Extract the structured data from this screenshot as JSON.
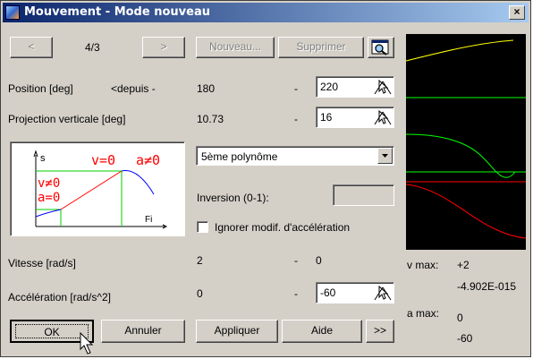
{
  "window": {
    "title": "Mouvement - Mode nouveau",
    "close": "×"
  },
  "nav": {
    "prev": "<",
    "page": "4/3",
    "next": ">"
  },
  "toolbar": {
    "nouveau": "Nouveau...",
    "supprimer": "Supprimer",
    "preview_icon": "magnifier-icon"
  },
  "position": {
    "label": "Position [deg]",
    "sub": "<depuis -",
    "value": "180",
    "dash": "-",
    "input": "220"
  },
  "projection": {
    "label": "Projection verticale [deg]",
    "value": "10.73",
    "dash": "-",
    "input": "16"
  },
  "diagram": {
    "s_label": "s",
    "v0": "v=0",
    "a_ne0": "a≠0",
    "v_ne0": "v≠0",
    "a0": "a=0",
    "fi": "Fi"
  },
  "profile": {
    "selected": "5ème polynôme"
  },
  "inversion": {
    "label": "Inversion (0-1):",
    "value": ""
  },
  "ignore_accel": {
    "label": "Ignorer modif. d'accélération",
    "checked": false
  },
  "vitesse": {
    "label": "Vitesse [rad/s]",
    "value": "2",
    "dash": "-",
    "value2": "0"
  },
  "acceleration": {
    "label": "Accélération [rad/s^2]",
    "value": "0",
    "dash": "-",
    "input": "-60"
  },
  "stats": {
    "vmax_label": "v max:",
    "vmax_top": "+2",
    "vmax_bottom": "-4.902E-015",
    "amax_label": "a max:",
    "amax_top": "0",
    "amax_bottom": "-60"
  },
  "buttons": {
    "ok": "OK",
    "annuler": "Annuler",
    "appliquer": "Appliquer",
    "aide": "Aide",
    "more": ">>"
  },
  "colors": {
    "title_start": "#0a246a",
    "title_end": "#a6caf0",
    "face": "#d4d0c8",
    "position_curve": "#ffff00",
    "velocity_curve": "#00ff00",
    "accel_curve": "#ff0000",
    "diagram_text": "#ff0000"
  }
}
